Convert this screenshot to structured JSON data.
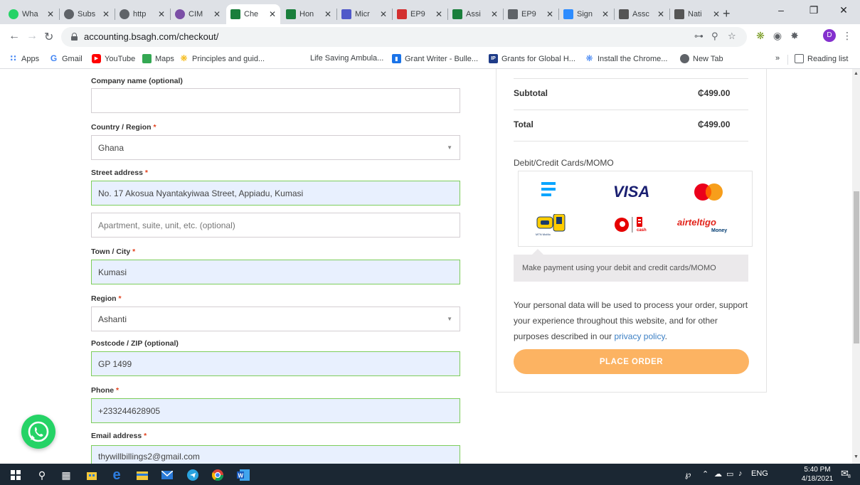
{
  "browser": {
    "tabs": [
      {
        "label": "Wha",
        "favicon_color": "#25d366"
      },
      {
        "label": "Subs",
        "favicon_color": "#5f6368"
      },
      {
        "label": "http",
        "favicon_color": "#5f6368"
      },
      {
        "label": "CIM",
        "favicon_color": "#7b4fa6"
      },
      {
        "label": "Che",
        "favicon_color": "#1a7f3c",
        "active": true
      },
      {
        "label": "Hon",
        "favicon_color": "#1a7f3c"
      },
      {
        "label": "Micr",
        "favicon_color": "#5059c9"
      },
      {
        "label": "EP9",
        "favicon_color": "#d32f2f"
      },
      {
        "label": "Assi",
        "favicon_color": "#1a7f3c"
      },
      {
        "label": "EP9",
        "favicon_color": "#5f6368"
      },
      {
        "label": "Sign",
        "favicon_color": "#2d8cff"
      },
      {
        "label": "Assc",
        "favicon_color": "#555555"
      },
      {
        "label": "Nati",
        "favicon_color": "#555555"
      }
    ],
    "url": "accounting.bsagh.com/checkout/",
    "bookmarks": [
      {
        "label": "Apps",
        "icon": "apps-grid-icon"
      },
      {
        "label": "Gmail",
        "icon": "google-icon"
      },
      {
        "label": "YouTube",
        "icon": "youtube-icon"
      },
      {
        "label": "Maps",
        "icon": "maps-icon"
      },
      {
        "label": "Principles and guid...",
        "icon": "sun-icon"
      },
      {
        "label": "Life Saving Ambula...",
        "icon": ""
      },
      {
        "label": "Grant Writer - Bulle...",
        "icon": "bookmark-icon"
      },
      {
        "label": "Grants for Global H...",
        "icon": "ip-icon"
      },
      {
        "label": "Install the Chrome...",
        "icon": "chrome-ext-icon"
      },
      {
        "label": "New Tab",
        "icon": "globe-icon"
      }
    ],
    "bookmarks_overflow": "»",
    "reading_list": "Reading list",
    "profile_initial": "D"
  },
  "form": {
    "company_label": "Company name (optional)",
    "company_value": "",
    "country_label": "Country / Region",
    "country_value": "Ghana",
    "street_label": "Street address",
    "street_value": "No. 17 Akosua Nyantakyiwaa Street, Appiadu, Kumasi",
    "street2_placeholder": "Apartment, suite, unit, etc. (optional)",
    "city_label": "Town / City",
    "city_value": "Kumasi",
    "region_label": "Region",
    "region_value": "Ashanti",
    "postcode_label": "Postcode / ZIP (optional)",
    "postcode_value": "GP 1499",
    "phone_label": "Phone",
    "phone_value": "+233244628905",
    "email_label": "Email address",
    "email_value": "thywillbillings2@gmail.com",
    "required_mark": "*"
  },
  "summary": {
    "subtotal_label": "Subtotal",
    "subtotal_value": "₵499.00",
    "total_label": "Total",
    "total_value": "₵499.00",
    "payment_method": "Debit/Credit Cards/MOMO",
    "payment_description": "Make payment using your debit and credit cards/MOMO",
    "privacy_text": "Your personal data will be used to process your order, support your experience throughout this website, and for other purposes described in our",
    "privacy_link": "privacy policy",
    "privacy_end": ".",
    "place_order": "PLACE ORDER",
    "logos": {
      "visa": "VISA",
      "airteltigo": "airteltigo",
      "airteltigo_sub": "Money",
      "mtn_sub": "MTN MoMo",
      "vodafone_sub": "cash"
    }
  },
  "taskbar": {
    "time": "5:40 PM",
    "date": "4/18/2021",
    "language": "ENG",
    "notification_count": "8"
  },
  "colors": {
    "accent": "#fcb362",
    "filled_field": "#e8f0fe",
    "required": "#e2401c",
    "link": "#3b7fc4"
  }
}
